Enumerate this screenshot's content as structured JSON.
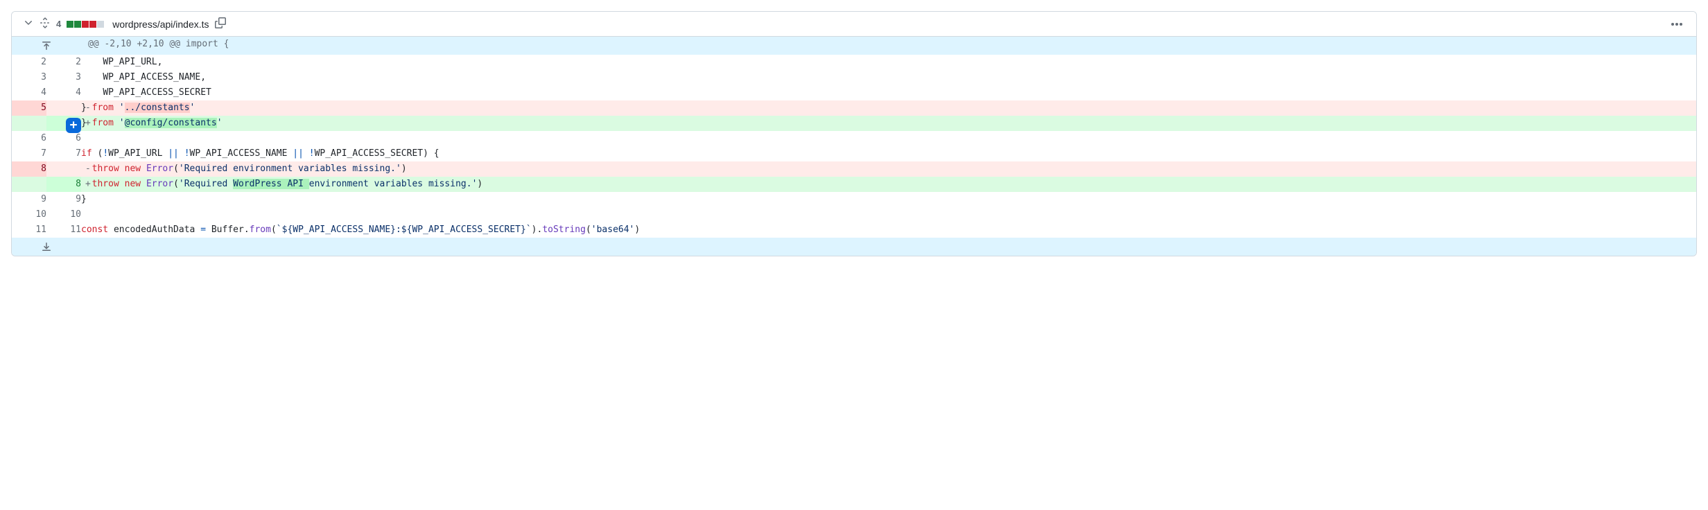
{
  "file": {
    "change_count": "4",
    "path": "wordpress/api/index.ts"
  },
  "hunk_header": "@@ -2,10 +2,10 @@ import {",
  "lines": [
    {
      "type": "context",
      "old": "2",
      "new": "2",
      "indent": "    ",
      "tokens": [
        {
          "t": "plain",
          "v": "WP_API_URL,"
        }
      ]
    },
    {
      "type": "context",
      "old": "3",
      "new": "3",
      "indent": "    ",
      "tokens": [
        {
          "t": "plain",
          "v": "WP_API_ACCESS_NAME,"
        }
      ]
    },
    {
      "type": "context",
      "old": "4",
      "new": "4",
      "indent": "    ",
      "tokens": [
        {
          "t": "plain",
          "v": "WP_API_ACCESS_SECRET"
        }
      ]
    },
    {
      "type": "deletion",
      "old": "5",
      "new": "",
      "indent": "",
      "tokens": [
        {
          "t": "plain",
          "v": "} "
        },
        {
          "t": "keyword",
          "v": "from"
        },
        {
          "t": "plain",
          "v": " "
        },
        {
          "t": "string",
          "v": "'"
        },
        {
          "t": "hl-del-string",
          "v": "../constants"
        },
        {
          "t": "string",
          "v": "'"
        }
      ]
    },
    {
      "type": "addition",
      "old": "",
      "new": "5",
      "indent": "",
      "has_add_btn": true,
      "tokens": [
        {
          "t": "plain",
          "v": "} "
        },
        {
          "t": "keyword",
          "v": "from"
        },
        {
          "t": "plain",
          "v": " "
        },
        {
          "t": "string",
          "v": "'"
        },
        {
          "t": "hl-add-string",
          "v": "@config/constants"
        },
        {
          "t": "string",
          "v": "'"
        }
      ]
    },
    {
      "type": "context",
      "old": "6",
      "new": "6",
      "indent": "",
      "tokens": []
    },
    {
      "type": "context",
      "old": "7",
      "new": "7",
      "indent": "",
      "tokens": [
        {
          "t": "keyword",
          "v": "if"
        },
        {
          "t": "plain",
          "v": " ("
        },
        {
          "t": "op",
          "v": "!"
        },
        {
          "t": "plain",
          "v": "WP_API_URL "
        },
        {
          "t": "op",
          "v": "||"
        },
        {
          "t": "plain",
          "v": " "
        },
        {
          "t": "op",
          "v": "!"
        },
        {
          "t": "plain",
          "v": "WP_API_ACCESS_NAME "
        },
        {
          "t": "op",
          "v": "||"
        },
        {
          "t": "plain",
          "v": " "
        },
        {
          "t": "op",
          "v": "!"
        },
        {
          "t": "plain",
          "v": "WP_API_ACCESS_SECRET) {"
        }
      ]
    },
    {
      "type": "deletion",
      "old": "8",
      "new": "",
      "indent": "  ",
      "tokens": [
        {
          "t": "keyword",
          "v": "throw"
        },
        {
          "t": "plain",
          "v": " "
        },
        {
          "t": "keyword",
          "v": "new"
        },
        {
          "t": "plain",
          "v": " "
        },
        {
          "t": "func",
          "v": "Error"
        },
        {
          "t": "plain",
          "v": "("
        },
        {
          "t": "string",
          "v": "'Required environment variables missing.'"
        },
        {
          "t": "plain",
          "v": ")"
        }
      ]
    },
    {
      "type": "addition",
      "old": "",
      "new": "8",
      "indent": "  ",
      "tokens": [
        {
          "t": "keyword",
          "v": "throw"
        },
        {
          "t": "plain",
          "v": " "
        },
        {
          "t": "keyword",
          "v": "new"
        },
        {
          "t": "plain",
          "v": " "
        },
        {
          "t": "func",
          "v": "Error"
        },
        {
          "t": "plain",
          "v": "("
        },
        {
          "t": "string",
          "v": "'Required "
        },
        {
          "t": "hl-add-string",
          "v": "WordPress API "
        },
        {
          "t": "string",
          "v": "environment variables missing.'"
        },
        {
          "t": "plain",
          "v": ")"
        }
      ]
    },
    {
      "type": "context",
      "old": "9",
      "new": "9",
      "indent": "",
      "tokens": [
        {
          "t": "plain",
          "v": "}"
        }
      ]
    },
    {
      "type": "context",
      "old": "10",
      "new": "10",
      "indent": "",
      "tokens": []
    },
    {
      "type": "context",
      "old": "11",
      "new": "11",
      "indent": "",
      "tokens": [
        {
          "t": "keyword",
          "v": "const"
        },
        {
          "t": "plain",
          "v": " encodedAuthData "
        },
        {
          "t": "op",
          "v": "="
        },
        {
          "t": "plain",
          "v": " Buffer."
        },
        {
          "t": "func",
          "v": "from"
        },
        {
          "t": "plain",
          "v": "("
        },
        {
          "t": "string",
          "v": "`${WP_API_ACCESS_NAME}:${WP_API_ACCESS_SECRET}`"
        },
        {
          "t": "plain",
          "v": ")."
        },
        {
          "t": "func",
          "v": "toString"
        },
        {
          "t": "plain",
          "v": "("
        },
        {
          "t": "string",
          "v": "'base64'"
        },
        {
          "t": "plain",
          "v": ")"
        }
      ]
    }
  ]
}
